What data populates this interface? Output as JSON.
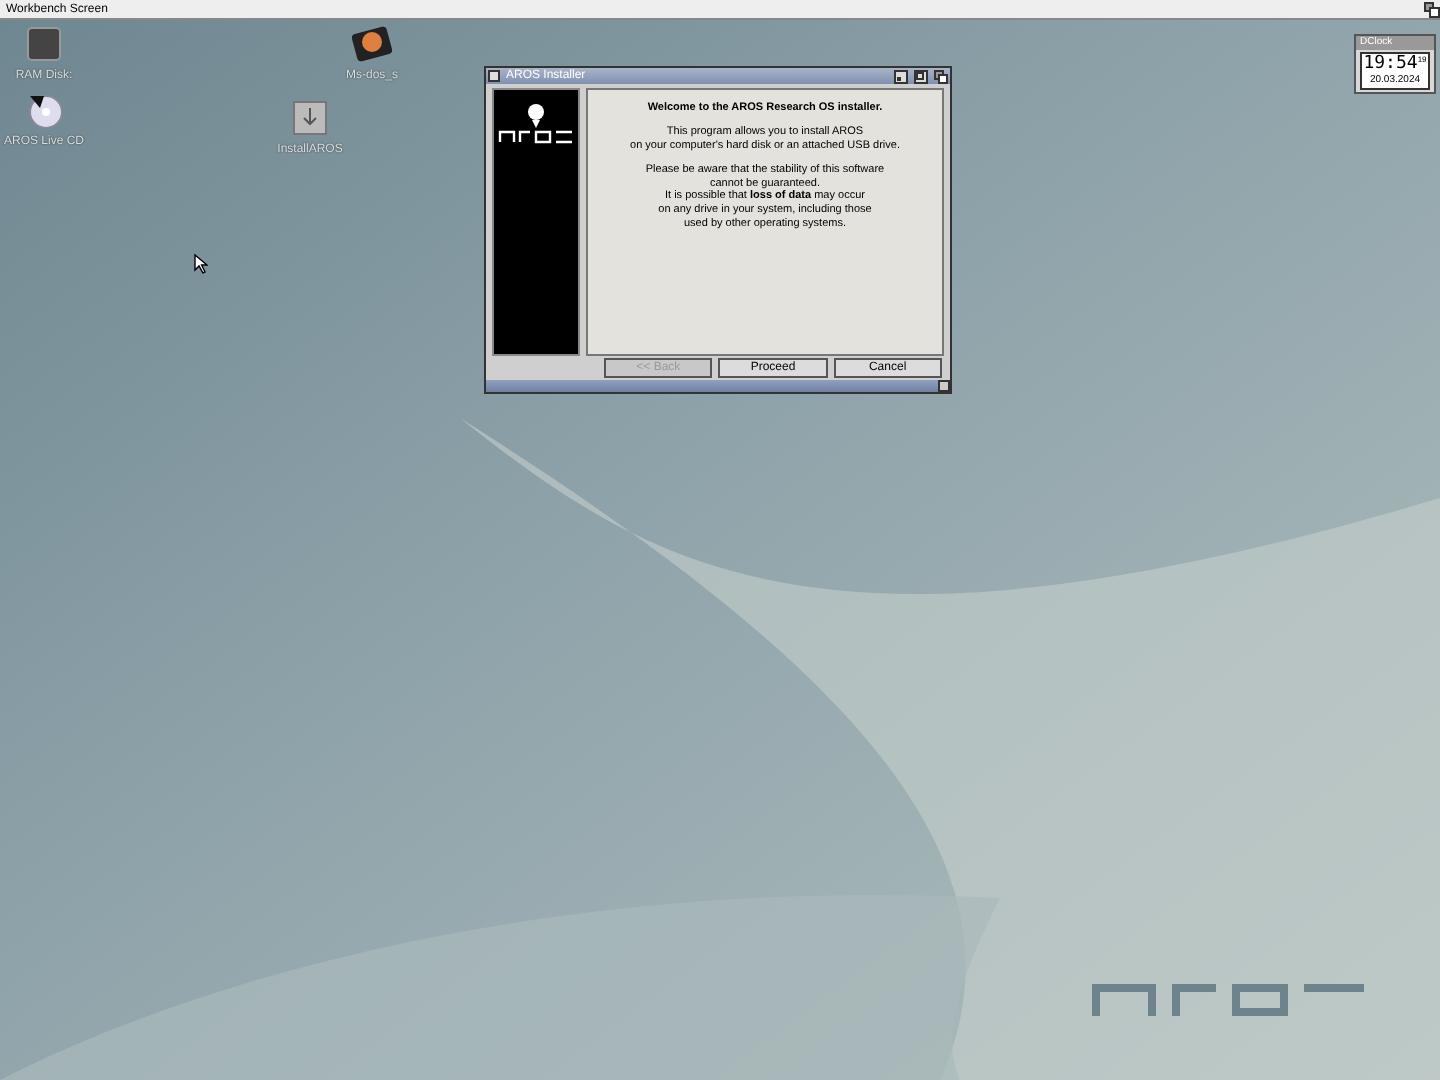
{
  "screen_title": "Workbench Screen",
  "desktop_icons": [
    {
      "label": "RAM Disk:",
      "kind": "ramdisk"
    },
    {
      "label": "AROS Live CD",
      "kind": "cd"
    },
    {
      "label": "Ms-dos_s",
      "kind": "harddisk"
    },
    {
      "label": "InstallAROS",
      "kind": "installer"
    }
  ],
  "installer": {
    "title": "AROS Installer",
    "heading": "Welcome to the AROS Research OS installer.",
    "paragraphs": [
      "This program allows you to install AROS\non your computer's hard disk or an attached USB drive.",
      "Please be aware that the stability of this software\ncannot be guaranteed.\nIt is possible that **loss of data** may occur\non any drive in your system, including those\nused by other operating systems."
    ],
    "buttons": [
      {
        "label": "<< Back",
        "disabled": true
      },
      {
        "label": "Proceed",
        "disabled": false
      },
      {
        "label": "Cancel",
        "disabled": false
      }
    ]
  },
  "clock": {
    "title": "DClock",
    "time": "19:54",
    "seconds": "19",
    "date": "20.03.2024"
  }
}
